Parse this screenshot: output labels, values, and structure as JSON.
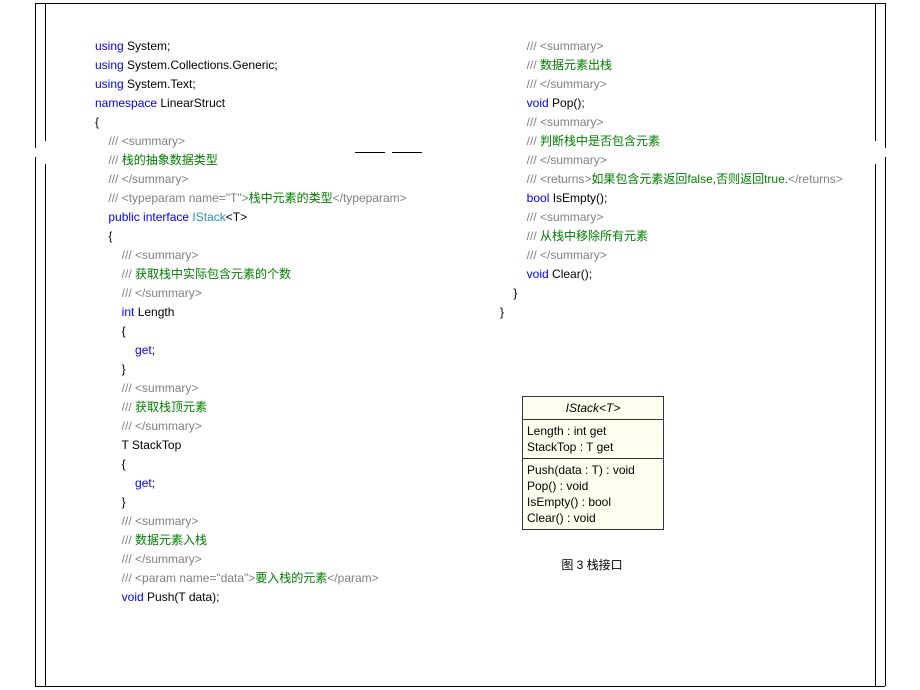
{
  "code_left": {
    "l1": {
      "kw": "using",
      "txt": " System;"
    },
    "l2": {
      "kw": "using",
      "txt": " System.Collections.Generic;"
    },
    "l3": {
      "kw": "using",
      "txt": " System.Text;"
    },
    "l4": {
      "kw": "namespace",
      "txt": " LinearStruct"
    },
    "l5": "{",
    "l6_g": "/// ",
    "l6_c": "<summary>",
    "l7_g": "/// ",
    "l7_c": "栈的抽象数据类型",
    "l8_g": "/// ",
    "l8_c": "</summary>",
    "l9_g": "/// ",
    "l9_ca": "<typeparam name=\"T\">",
    "l9_cb": "栈中元素的类型",
    "l9_cc": "</typeparam>",
    "l10_kw": "public interface ",
    "l10_t": "IStack",
    "l10_p": "<T>",
    "l11": "{",
    "l12_g": "/// ",
    "l12_c": "<summary>",
    "l13_g": "/// ",
    "l13_c": "获取栈中实际包含元素的个数",
    "l14_g": "/// ",
    "l14_c": "</summary>",
    "l15_kw": "int",
    "l15_p": " Length",
    "l16": "{",
    "l17_kw": "get",
    "l17_p": ";",
    "l18": "}",
    "l19_g": "/// ",
    "l19_c": "<summary>",
    "l20_g": "/// ",
    "l20_c": "获取栈顶元素",
    "l21_g": "/// ",
    "l21_c": "</summary>",
    "l22": "T StackTop",
    "l23": "{",
    "l24_kw": "get",
    "l24_p": ";",
    "l25": "}",
    "l26_g": "/// ",
    "l26_c": "<summary>",
    "l27_g": "/// ",
    "l27_c": "数据元素入栈",
    "l28_g": "/// ",
    "l28_c": "</summary>",
    "l29_g": "/// ",
    "l29_ca": "<param name=\"data\">",
    "l29_cb": "要入栈的元素",
    "l29_cc": "</param>",
    "l30_kw": "void",
    "l30_p": " Push(T data);"
  },
  "code_right": {
    "r1_g": "/// ",
    "r1_c": "<summary>",
    "r2_g": "/// ",
    "r2_c": "数据元素出栈",
    "r3_g": "/// ",
    "r3_c": "</summary>",
    "r4_kw": "void",
    "r4_p": " Pop();",
    "r5_g": "/// ",
    "r5_c": "<summary>",
    "r6_g": "/// ",
    "r6_c": "判断栈中是否包含元素",
    "r7_g": "/// ",
    "r7_c": "</summary>",
    "r8_g": "/// ",
    "r8_ca": "<returns>",
    "r8_cb": "如果包含元素返回false,否则返回true.",
    "r8_cc": "</returns>",
    "r9_kw": "bool",
    "r9_p": " IsEmpty();",
    "r10_g": "/// ",
    "r10_c": "<summary>",
    "r11_g": "/// ",
    "r11_c": "从栈中移除所有元素",
    "r12_g": "/// ",
    "r12_c": "</summary>",
    "r13_kw": "void",
    "r13_p": " Clear();",
    "r14": "}",
    "r15": "}"
  },
  "uml": {
    "title": "IStack<T>",
    "p1": "Length : int get",
    "p2": "StackTop : T get",
    "m1": "Push(data : T) : void",
    "m2": "Pop() : void",
    "m3": "IsEmpty() : bool",
    "m4": "Clear() : void"
  },
  "caption": "图 3 栈接口"
}
